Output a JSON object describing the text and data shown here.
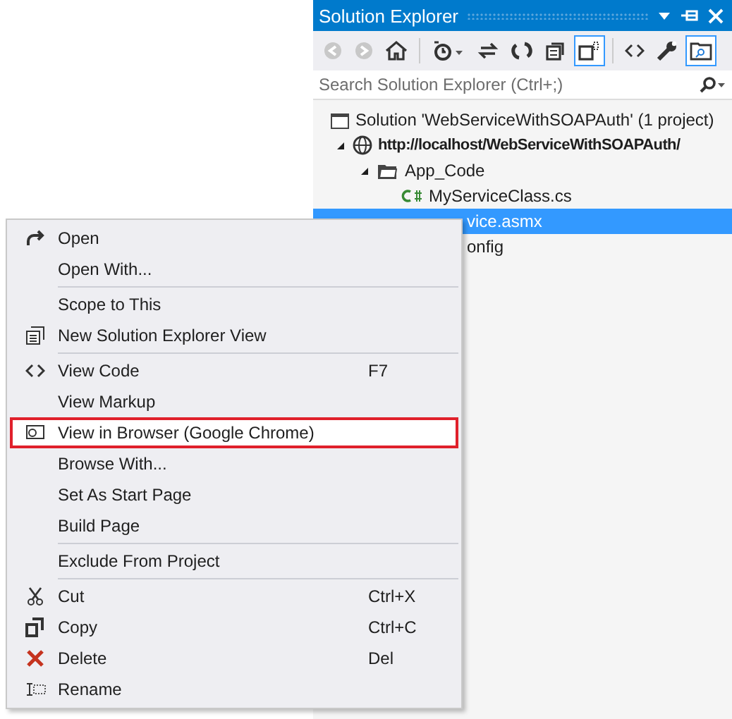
{
  "explorer": {
    "title": "Solution Explorer",
    "toolbar": [
      {
        "kind": "back",
        "pressed": false
      },
      {
        "kind": "forward",
        "pressed": false
      },
      {
        "kind": "home",
        "pressed": false
      },
      {
        "kind": "separator"
      },
      {
        "kind": "history",
        "pressed": false
      },
      {
        "kind": "sync",
        "pressed": false
      },
      {
        "kind": "refresh",
        "pressed": false
      },
      {
        "kind": "collapse",
        "pressed": false
      },
      {
        "kind": "show-all",
        "pressed": true
      },
      {
        "kind": "separator"
      },
      {
        "kind": "code",
        "pressed": false
      },
      {
        "kind": "properties",
        "pressed": false
      },
      {
        "kind": "preview",
        "pressed": true
      }
    ],
    "search": {
      "placeholder": "Search Solution Explorer (Ctrl+;)"
    },
    "tree": [
      {
        "kind": "solution",
        "name": "Solution 'WebServiceWithSOAPAuth' (1 project)",
        "selected": false,
        "children": [
          {
            "kind": "project",
            "name": "http://localhost/WebServiceWithSOAPAuth/",
            "selected": false,
            "expanded": true,
            "children": [
              {
                "kind": "folder",
                "name": "App_Code",
                "selected": false,
                "expanded": true,
                "children": [
                  {
                    "kind": "csharp",
                    "name": "MyServiceClass.cs",
                    "selected": false
                  }
                ]
              },
              {
                "kind": "partial",
                "name": "vice.asmx",
                "selected": true
              },
              {
                "kind": "partial",
                "name": "onfig",
                "selected": false
              }
            ]
          }
        ]
      }
    ]
  },
  "context_menu": [
    {
      "kind": "open",
      "label": "Open",
      "highlighted": false
    },
    {
      "kind": "plain",
      "label": "Open With...",
      "highlighted": false
    },
    {
      "kind": "separator"
    },
    {
      "kind": "plain",
      "label": "Scope to This",
      "highlighted": false
    },
    {
      "kind": "new-view",
      "label": "New Solution Explorer View",
      "highlighted": false
    },
    {
      "kind": "separator"
    },
    {
      "kind": "code",
      "label": "View Code",
      "shortcut": "F7",
      "highlighted": false
    },
    {
      "kind": "plain",
      "label": "View Markup",
      "highlighted": false
    },
    {
      "kind": "browser",
      "label": "View in Browser (Google Chrome)",
      "highlighted": true
    },
    {
      "kind": "plain",
      "label": "Browse With...",
      "highlighted": false
    },
    {
      "kind": "plain",
      "label": "Set As Start Page",
      "highlighted": false
    },
    {
      "kind": "plain",
      "label": "Build Page",
      "highlighted": false
    },
    {
      "kind": "separator"
    },
    {
      "kind": "plain",
      "label": "Exclude From Project",
      "highlighted": false
    },
    {
      "kind": "separator"
    },
    {
      "kind": "cut",
      "label": "Cut",
      "shortcut": "Ctrl+X",
      "highlighted": false
    },
    {
      "kind": "copy",
      "label": "Copy",
      "shortcut": "Ctrl+C",
      "highlighted": false
    },
    {
      "kind": "delete",
      "label": "Delete",
      "shortcut": "Del",
      "highlighted": false
    },
    {
      "kind": "rename",
      "label": "Rename",
      "highlighted": false
    }
  ]
}
